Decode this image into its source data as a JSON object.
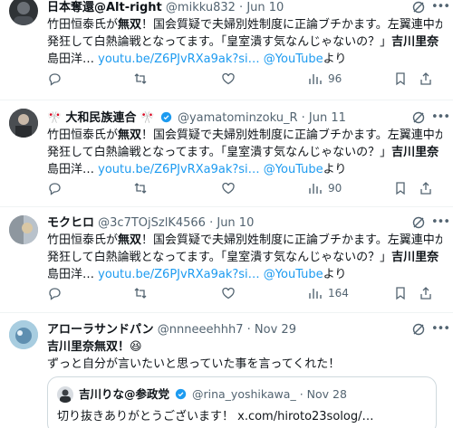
{
  "tweets": [
    {
      "name": "日本奪還@Alt-right",
      "handle": "@mikku832",
      "dot": "·",
      "date": "Jun 10",
      "lines": {
        "l1a": "竹田恒泰氏が",
        "l1b": "無双",
        "l1c": "！国会質疑で夫婦別姓制度に正論ブチかます。左翼連中が",
        "l2a": "発狂して白熱論戦となってます。「皇室潰す気なんじゃないの？」",
        "l2b": "吉川里奈",
        "l3a": "島田洋…",
        "l3b": "youtu.be/Z6PJvRXa9ak?si…",
        "l3c": "@YouTube",
        "l3d": "より"
      },
      "views": "96"
    },
    {
      "name": "大和民族連合",
      "name_decor": "🎌",
      "handle": "@yamatominzoku_R",
      "dot": "·",
      "date": "Jun 11",
      "lines": {
        "l1a": "竹田恒泰氏が",
        "l1b": "無双",
        "l1c": "！国会質疑で夫婦別姓制度に正論ブチかます。左翼連中が",
        "l2a": "発狂して白熱論戦となってます。「皇室潰す気なんじゃないの？」",
        "l2b": "吉川里奈",
        "l3a": "島田洋…",
        "l3b": "youtu.be/Z6PJvRXa9ak?si…",
        "l3c": "@YouTube",
        "l3d": "より"
      },
      "views": "90"
    },
    {
      "name": "モクヒロ",
      "handle": "@3c7TOjSzlK4566",
      "dot": "·",
      "date": "Jun 10",
      "lines": {
        "l1a": "竹田恒泰氏が",
        "l1b": "無双",
        "l1c": "！国会質疑で夫婦別姓制度に正論ブチかます。左翼連中が",
        "l2a": "発狂して白熱論戦となってます。「皇室潰す気なんじゃないの？」",
        "l2b": "吉川里奈",
        "l3a": "島田洋…",
        "l3b": "youtu.be/Z6PJvRXa9ak?si…",
        "l3c": "@YouTube",
        "l3d": "より"
      },
      "views": "164"
    },
    {
      "name": "アローラサンドパン",
      "handle": "@nnneeehhh7",
      "dot": "·",
      "date": "Nov 29",
      "line1": "吉川里奈無双！😆",
      "line2": "ずっと自分が言いたいと思っていた事を言ってくれた！",
      "quote": {
        "name": "吉川りな@参政党",
        "handle": "@rina_yoshikawa_",
        "dot": "·",
        "date": "Nov 28",
        "text": "切り抜きありがとうございます！ x.com/hiroto23solog/…"
      }
    }
  ],
  "colors": {
    "accent": "#1d9bf0",
    "muted": "#536471",
    "verified": "#1d9bf0",
    "border": "#eff3f4"
  },
  "icons": [
    "grok-icon",
    "more-icon",
    "reply-icon",
    "retweet-icon",
    "like-icon",
    "views-icon",
    "bookmark-icon",
    "share-icon",
    "verified-badge-icon"
  ]
}
